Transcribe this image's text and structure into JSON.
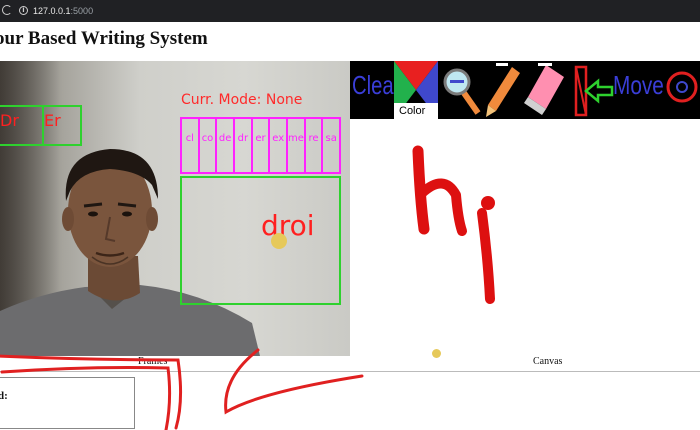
{
  "browser": {
    "url_host": "127.0.0.1",
    "url_port": ":5000"
  },
  "page": {
    "title": "our Based Writing System"
  },
  "frame": {
    "hud_letters": [
      "Dr",
      "Er"
    ],
    "mode_text": "Curr. Mode: None",
    "suggestions": [
      "cl",
      "co",
      "de",
      "dr",
      "er",
      "ex",
      "me",
      "re",
      "sa"
    ],
    "typed_text": "droi",
    "caption": "Frames"
  },
  "canvas": {
    "toolbar": {
      "clear_label": "Clear",
      "color_label": "Color",
      "move_label": "Move"
    },
    "drawn_text": "hi",
    "caption": "Canvas"
  },
  "detected": {
    "label": "d:"
  },
  "colors": {
    "hud_green": "#2ed12e",
    "hud_red": "#ff2020",
    "suggestion_magenta": "#ff22ff",
    "toolbar_blue": "#3a3ed8",
    "ink_red": "#dd1010",
    "annotation_red": "#e02020"
  },
  "icons": [
    "reload-icon",
    "info-icon",
    "color-picker-icon",
    "magnifier-icon",
    "pencil-icon",
    "eraser-icon",
    "move-arrow-icon",
    "settings-icon"
  ]
}
